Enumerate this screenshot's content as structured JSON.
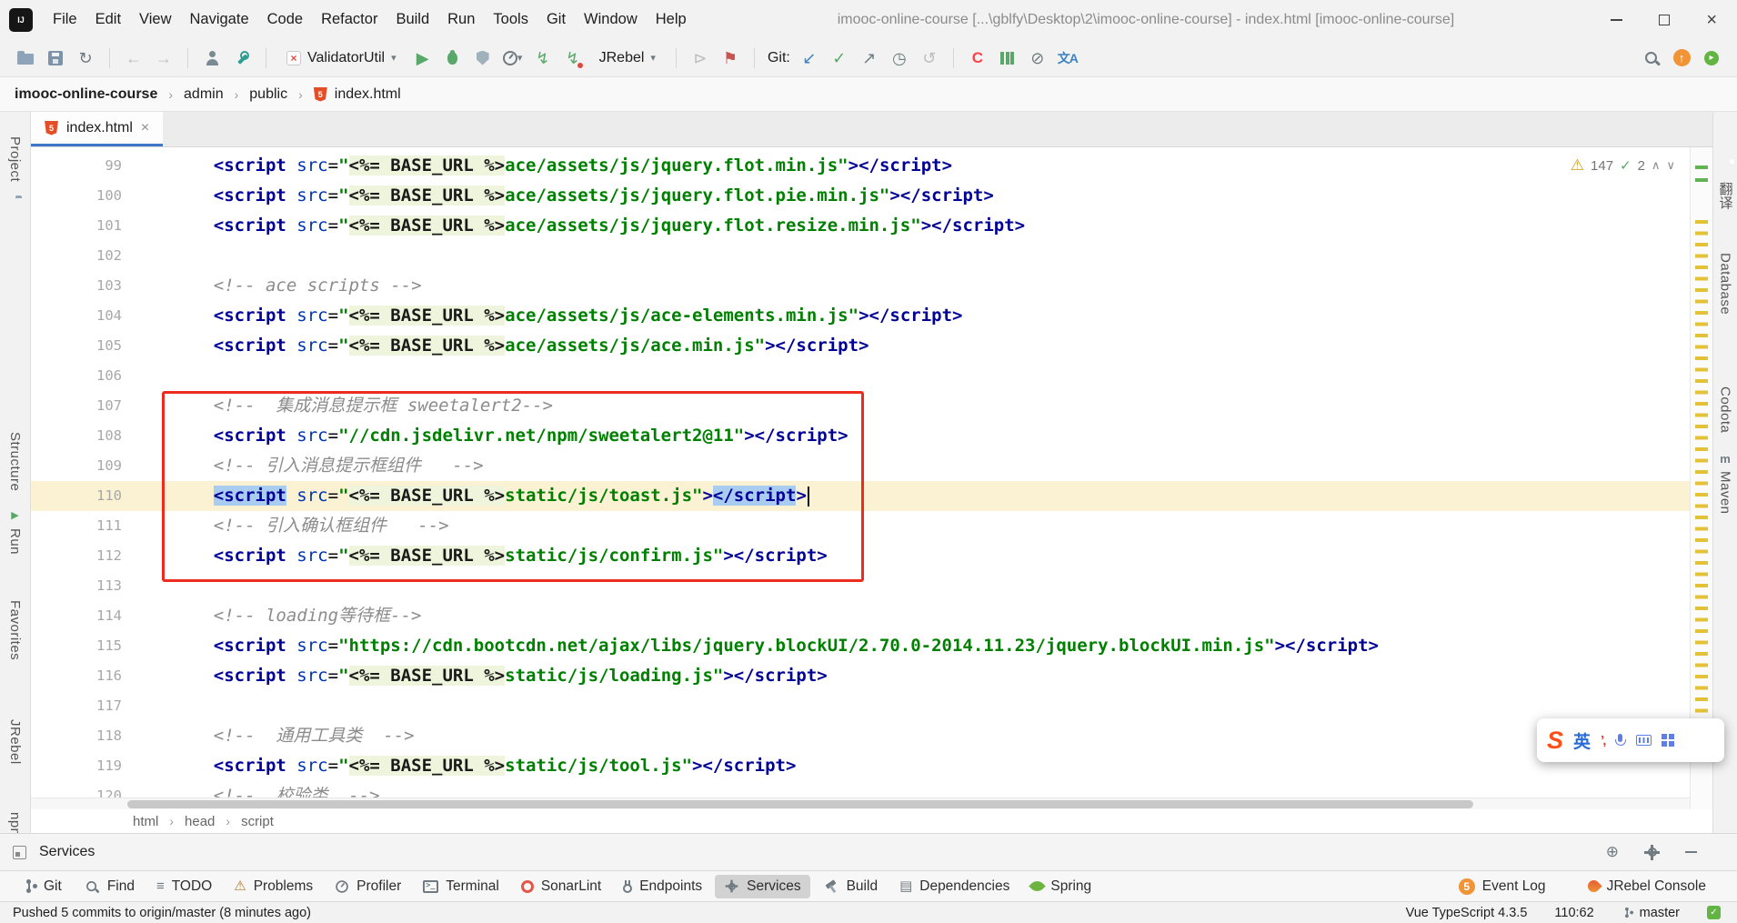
{
  "window": {
    "title": "imooc-online-course [...\\gblfy\\Desktop\\2\\imooc-online-course] - index.html [imooc-online-course]",
    "menus": [
      "File",
      "Edit",
      "View",
      "Navigate",
      "Code",
      "Refactor",
      "Build",
      "Run",
      "Tools",
      "Git",
      "Window",
      "Help"
    ]
  },
  "toolbar": {
    "run_config": "ValidatorUtil",
    "jrebel": "JRebel",
    "git_label": "Git:"
  },
  "path_bar": [
    "imooc-online-course",
    "admin",
    "public",
    "index.html"
  ],
  "tab": {
    "label": "index.html"
  },
  "editor": {
    "inspections": {
      "warnings": "147",
      "spell": "2"
    },
    "lines": [
      {
        "n": "99",
        "seg": [
          [
            "p",
            "    "
          ],
          [
            "t",
            "<script"
          ],
          [
            "p",
            " "
          ],
          [
            "a",
            "src"
          ],
          [
            "p",
            "="
          ],
          [
            "s",
            "\""
          ],
          [
            "e",
            "<%= BASE_URL %>"
          ],
          [
            "s",
            "ace/assets/js/jquery.flot.min.js\""
          ],
          [
            "t",
            "></script>"
          ]
        ]
      },
      {
        "n": "100",
        "seg": [
          [
            "p",
            "    "
          ],
          [
            "t",
            "<script"
          ],
          [
            "p",
            " "
          ],
          [
            "a",
            "src"
          ],
          [
            "p",
            "="
          ],
          [
            "s",
            "\""
          ],
          [
            "e",
            "<%= BASE_URL %>"
          ],
          [
            "s",
            "ace/assets/js/jquery.flot.pie.min.js\""
          ],
          [
            "t",
            "></script>"
          ]
        ]
      },
      {
        "n": "101",
        "seg": [
          [
            "p",
            "    "
          ],
          [
            "t",
            "<script"
          ],
          [
            "p",
            " "
          ],
          [
            "a",
            "src"
          ],
          [
            "p",
            "="
          ],
          [
            "s",
            "\""
          ],
          [
            "e",
            "<%= BASE_URL %>"
          ],
          [
            "s",
            "ace/assets/js/jquery.flot.resize.min.js\""
          ],
          [
            "t",
            "></script>"
          ]
        ]
      },
      {
        "n": "102",
        "seg": []
      },
      {
        "n": "103",
        "seg": [
          [
            "p",
            "    "
          ],
          [
            "c",
            "<!-- ace scripts -->"
          ]
        ]
      },
      {
        "n": "104",
        "seg": [
          [
            "p",
            "    "
          ],
          [
            "t",
            "<script"
          ],
          [
            "p",
            " "
          ],
          [
            "a",
            "src"
          ],
          [
            "p",
            "="
          ],
          [
            "s",
            "\""
          ],
          [
            "e",
            "<%= BASE_URL %>"
          ],
          [
            "s",
            "ace/assets/js/ace-elements.min.js\""
          ],
          [
            "t",
            "></script>"
          ]
        ]
      },
      {
        "n": "105",
        "seg": [
          [
            "p",
            "    "
          ],
          [
            "t",
            "<script"
          ],
          [
            "p",
            " "
          ],
          [
            "a",
            "src"
          ],
          [
            "p",
            "="
          ],
          [
            "s",
            "\""
          ],
          [
            "e",
            "<%= BASE_URL %>"
          ],
          [
            "s",
            "ace/assets/js/ace.min.js\""
          ],
          [
            "t",
            "></script>"
          ]
        ]
      },
      {
        "n": "106",
        "seg": []
      },
      {
        "n": "107",
        "seg": [
          [
            "p",
            "    "
          ],
          [
            "c",
            "<!--  集成消息提示框 sweetalert2-->"
          ]
        ]
      },
      {
        "n": "108",
        "seg": [
          [
            "p",
            "    "
          ],
          [
            "t",
            "<script"
          ],
          [
            "p",
            " "
          ],
          [
            "a",
            "src"
          ],
          [
            "p",
            "="
          ],
          [
            "s",
            "\"//cdn.jsdelivr.net/npm/sweetalert2@11\""
          ],
          [
            "t",
            "></script>"
          ]
        ]
      },
      {
        "n": "109",
        "seg": [
          [
            "p",
            "    "
          ],
          [
            "c",
            "<!-- 引入消息提示框组件   -->"
          ]
        ]
      },
      {
        "n": "110",
        "cur": true,
        "caret": true,
        "seg": [
          [
            "p",
            "    "
          ],
          [
            "h",
            "<script"
          ],
          [
            "p",
            " "
          ],
          [
            "a",
            "src"
          ],
          [
            "p",
            "="
          ],
          [
            "s",
            "\""
          ],
          [
            "e",
            "<%= BASE_URL %>"
          ],
          [
            "s",
            "static/js/toast.js\""
          ],
          [
            "t",
            ">"
          ],
          [
            "h",
            "</script"
          ],
          [
            "t",
            ">"
          ]
        ]
      },
      {
        "n": "111",
        "seg": [
          [
            "p",
            "    "
          ],
          [
            "c",
            "<!-- 引入确认框组件   -->"
          ]
        ]
      },
      {
        "n": "112",
        "seg": [
          [
            "p",
            "    "
          ],
          [
            "t",
            "<script"
          ],
          [
            "p",
            " "
          ],
          [
            "a",
            "src"
          ],
          [
            "p",
            "="
          ],
          [
            "s",
            "\""
          ],
          [
            "e",
            "<%= BASE_URL %>"
          ],
          [
            "s",
            "static/js/confirm.js\""
          ],
          [
            "t",
            "></script>"
          ]
        ]
      },
      {
        "n": "113",
        "seg": []
      },
      {
        "n": "114",
        "seg": [
          [
            "p",
            "    "
          ],
          [
            "c",
            "<!-- loading等待框-->"
          ]
        ]
      },
      {
        "n": "115",
        "seg": [
          [
            "p",
            "    "
          ],
          [
            "t",
            "<script"
          ],
          [
            "p",
            " "
          ],
          [
            "a",
            "src"
          ],
          [
            "p",
            "="
          ],
          [
            "s",
            "\"https://cdn.bootcdn.net/ajax/libs/jquery.blockUI/2.70.0-2014.11.23/jquery.blockUI.min.js\""
          ],
          [
            "t",
            "></script>"
          ]
        ]
      },
      {
        "n": "116",
        "seg": [
          [
            "p",
            "    "
          ],
          [
            "t",
            "<script"
          ],
          [
            "p",
            " "
          ],
          [
            "a",
            "src"
          ],
          [
            "p",
            "="
          ],
          [
            "s",
            "\""
          ],
          [
            "e",
            "<%= BASE_URL %>"
          ],
          [
            "s",
            "static/js/loading.js\""
          ],
          [
            "t",
            "></script>"
          ]
        ]
      },
      {
        "n": "117",
        "seg": []
      },
      {
        "n": "118",
        "seg": [
          [
            "p",
            "    "
          ],
          [
            "c",
            "<!--  通用工具类  -->"
          ]
        ]
      },
      {
        "n": "119",
        "seg": [
          [
            "p",
            "    "
          ],
          [
            "t",
            "<script"
          ],
          [
            "p",
            " "
          ],
          [
            "a",
            "src"
          ],
          [
            "p",
            "="
          ],
          [
            "s",
            "\""
          ],
          [
            "e",
            "<%= BASE_URL %>"
          ],
          [
            "s",
            "static/js/tool.js\""
          ],
          [
            "t",
            "></script>"
          ]
        ]
      },
      {
        "n": "120",
        "seg": [
          [
            "p",
            "    "
          ],
          [
            "c",
            "<!--  校验类  -->"
          ]
        ]
      }
    ]
  },
  "footer_crumbs": [
    "html",
    "head",
    "script"
  ],
  "services": {
    "title": "Services"
  },
  "tool_bar": {
    "items": [
      "Git",
      "Find",
      "TODO",
      "Problems",
      "Profiler",
      "Terminal",
      "SonarLint",
      "Endpoints",
      "Services",
      "Build",
      "Dependencies",
      "Spring"
    ],
    "event_log": {
      "badge": "5",
      "label": "Event Log"
    },
    "jrebel_console": "JRebel Console"
  },
  "status_bar": {
    "message": "Pushed 5 commits to origin/master (8 minutes ago)",
    "typescript": "Vue TypeScript 4.3.5",
    "caret": "110:62",
    "branch": "master"
  },
  "left_stripe": [
    "Project",
    "Structure",
    "Run",
    "Favorites",
    "JRebel",
    "npm"
  ],
  "right_stripe": [
    "翻译",
    "Database",
    "Codota",
    "Maven"
  ],
  "ime": {
    "lang": "英"
  }
}
